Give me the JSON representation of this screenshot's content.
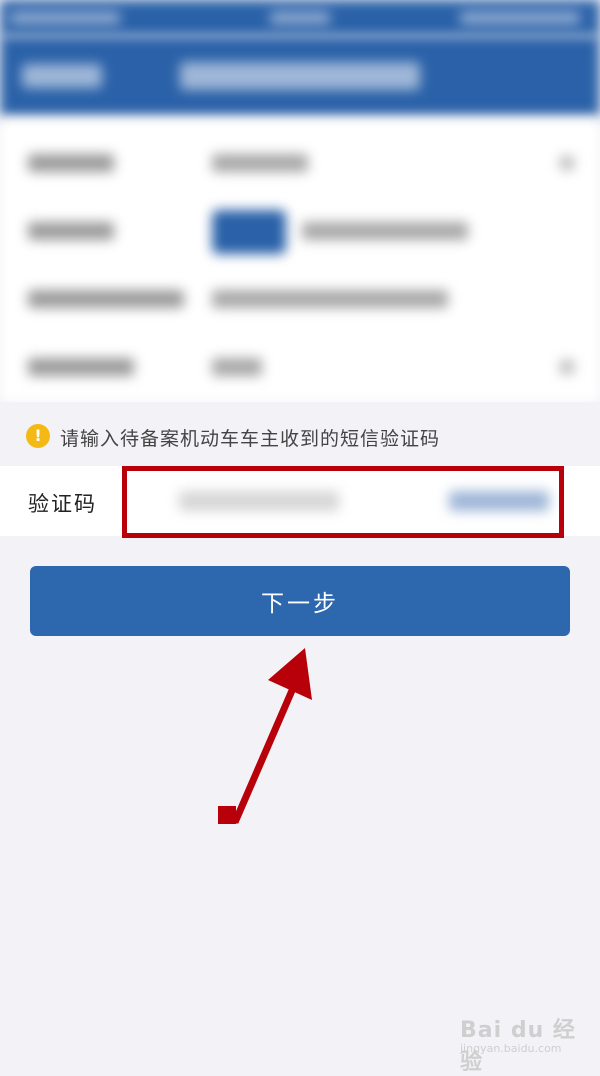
{
  "notice": {
    "text": "请输入待备案机动车车主收到的短信验证码",
    "icon": "warning-icon",
    "icon_color": "#f5b915"
  },
  "verification": {
    "label": "验证码"
  },
  "next_button": {
    "label": "下一步",
    "color": "#2d67ae"
  },
  "annotation": {
    "highlight_color": "#b8000a"
  },
  "watermark": {
    "main": "Bai du 经验",
    "sub": "jingyan.baidu.com"
  },
  "colors": {
    "nav": "#2a61a8",
    "background": "#f3f3f7"
  }
}
